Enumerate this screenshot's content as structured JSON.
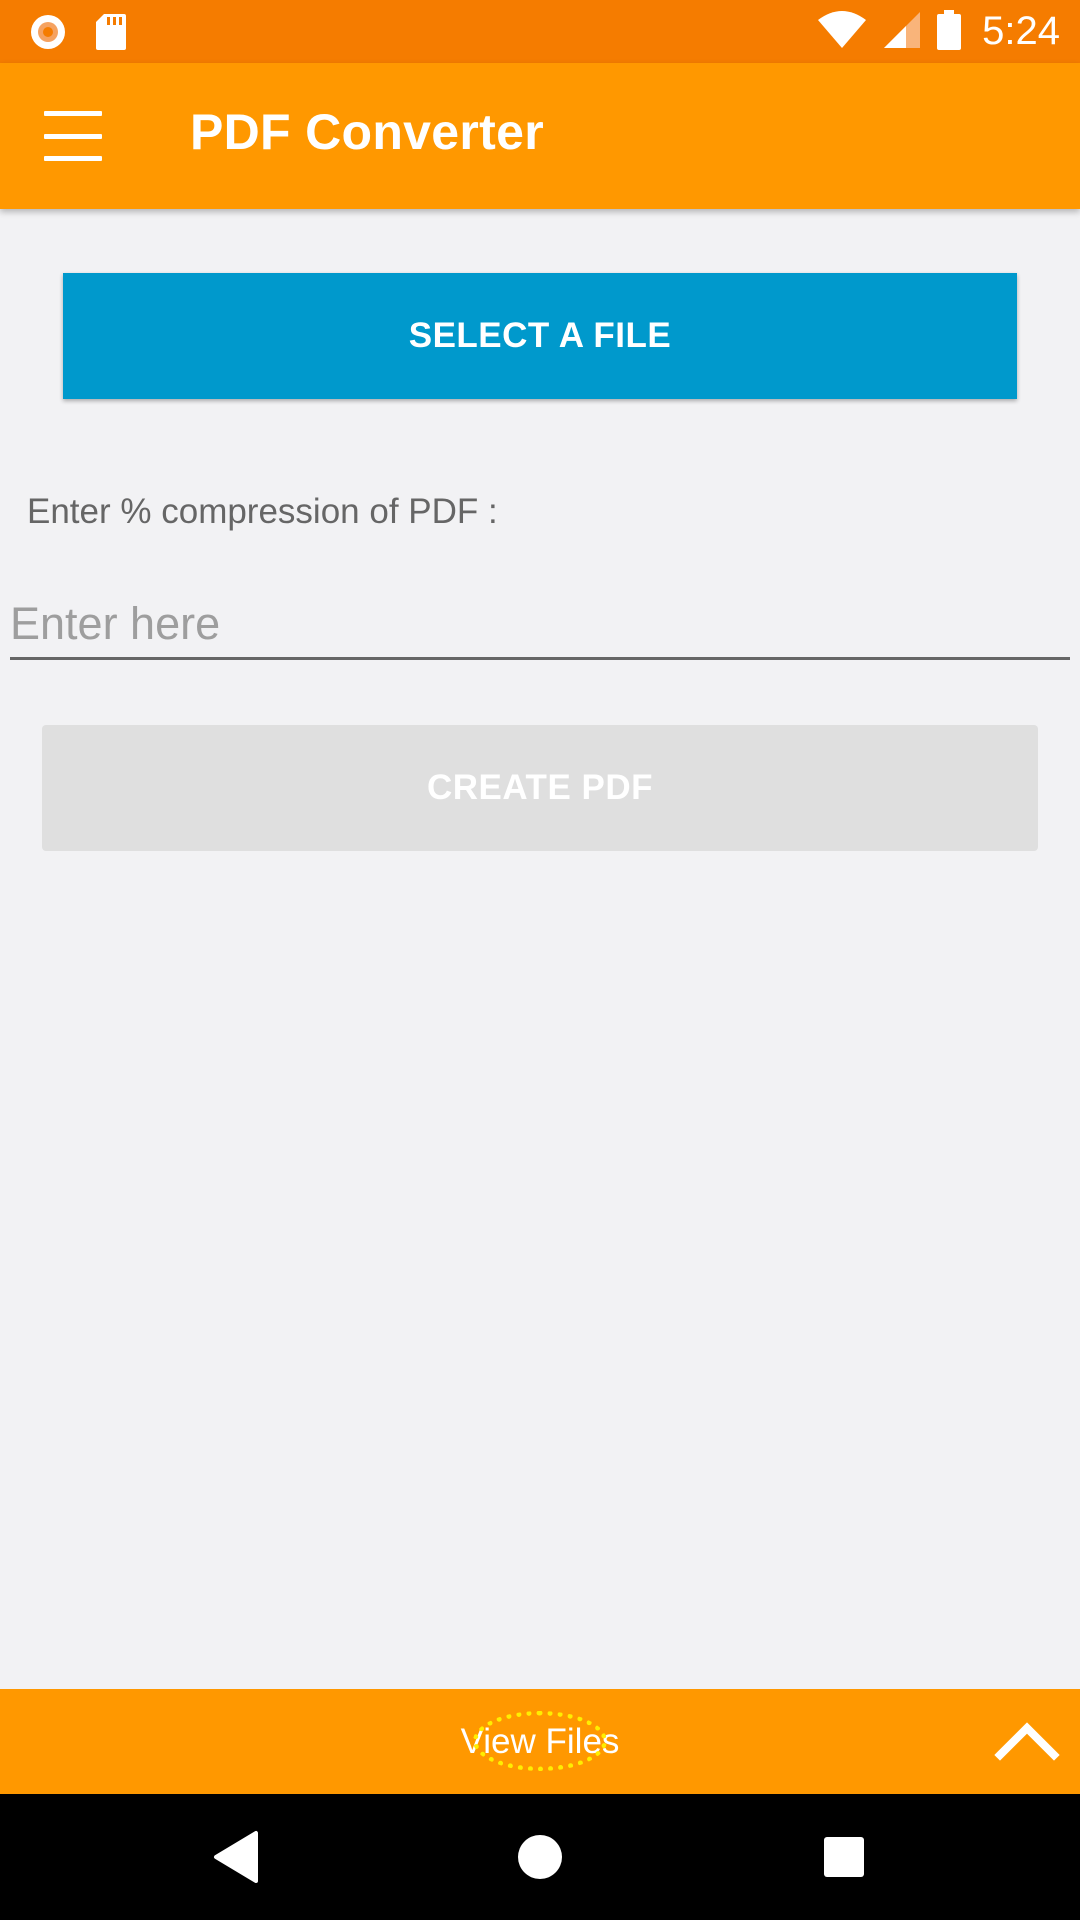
{
  "status_bar": {
    "time": "5:24",
    "icons": [
      "record-icon",
      "sd-card-icon",
      "wifi-icon",
      "signal-icon",
      "battery-icon"
    ]
  },
  "app_bar": {
    "title": "PDF Converter",
    "menu_icon": "hamburger-menu-icon"
  },
  "main": {
    "select_file_label": "SELECT A FILE",
    "compression_label": "Enter % compression of PDF :",
    "compression_input": {
      "value": "",
      "placeholder": "Enter here"
    },
    "create_pdf_label": "CREATE PDF",
    "create_pdf_enabled": false
  },
  "bottom_sheet": {
    "label": "View Files",
    "expand_icon": "chevron-up-icon"
  },
  "nav_bar": {
    "buttons": [
      "back-icon",
      "home-icon",
      "recents-icon"
    ]
  },
  "colors": {
    "status_bar": "#f57c00",
    "app_bar": "#ff9800",
    "select_button": "#0099cc",
    "create_button_disabled": "#dfdfdf",
    "background": "#f2f2f4",
    "nav_bar": "#000000"
  }
}
